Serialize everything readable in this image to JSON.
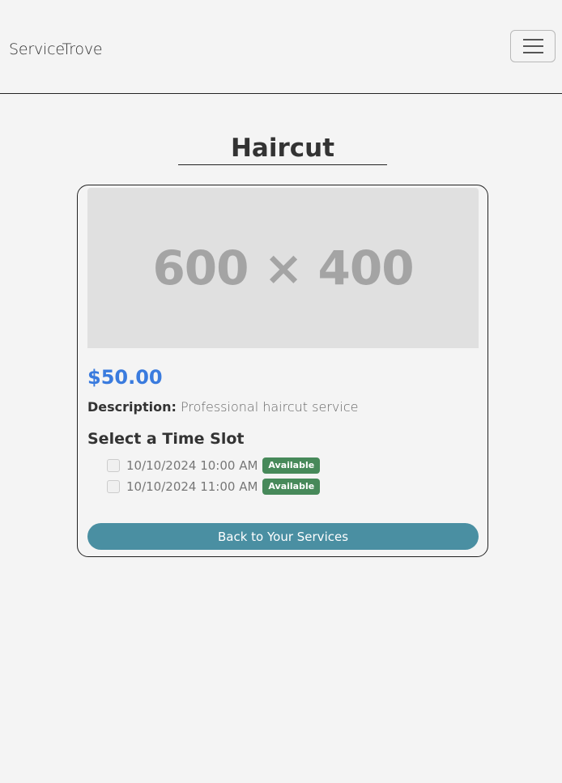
{
  "navbar": {
    "brand": "ServiceTrove",
    "toggle_icon": "hamburger-menu-icon"
  },
  "page": {
    "title": "Haircut"
  },
  "service": {
    "image_placeholder": "600 × 400",
    "price": "$50.00",
    "description_label": "Description:",
    "description": "Professional haircut service",
    "slots_heading": "Select a Time Slot",
    "slots": [
      {
        "time": "10/10/2024 10:00 AM",
        "status": "Available",
        "checked": false
      },
      {
        "time": "10/10/2024 11:00 AM",
        "status": "Available",
        "checked": false
      }
    ],
    "back_button_label": "Back to Your Services"
  },
  "colors": {
    "accent_price": "#3a7bde",
    "badge_available": "#47895a",
    "button": "#4a8fa2",
    "background": "#f4f4f4"
  }
}
